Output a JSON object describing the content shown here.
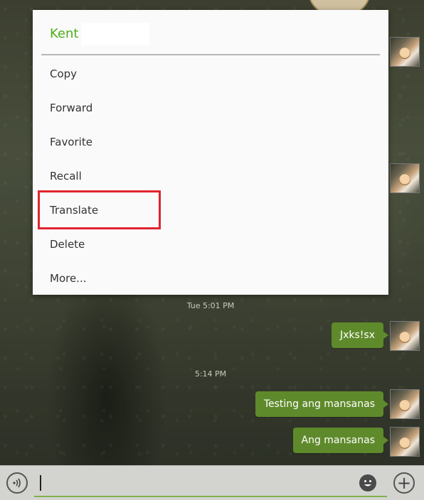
{
  "menu": {
    "title": "Kent",
    "items": [
      {
        "label": "Copy"
      },
      {
        "label": "Forward"
      },
      {
        "label": "Favorite"
      },
      {
        "label": "Recall"
      },
      {
        "label": "Translate"
      },
      {
        "label": "Delete"
      },
      {
        "label": "More..."
      }
    ],
    "highlighted_item": "Translate"
  },
  "chat": {
    "timestamps": [
      "Tue 5:01 PM",
      "5:14 PM"
    ],
    "messages": [
      {
        "text": "Jxks!sx"
      },
      {
        "text": "Testing ang mansanas"
      },
      {
        "text": "Ang mansanas"
      }
    ]
  },
  "input_bar": {
    "value": "",
    "icons": [
      "voice-icon",
      "emoji-icon",
      "plus-icon"
    ]
  },
  "colors": {
    "accent": "#4caf1a",
    "bubble": "#5f8a2b",
    "highlight": "#e0242f"
  }
}
